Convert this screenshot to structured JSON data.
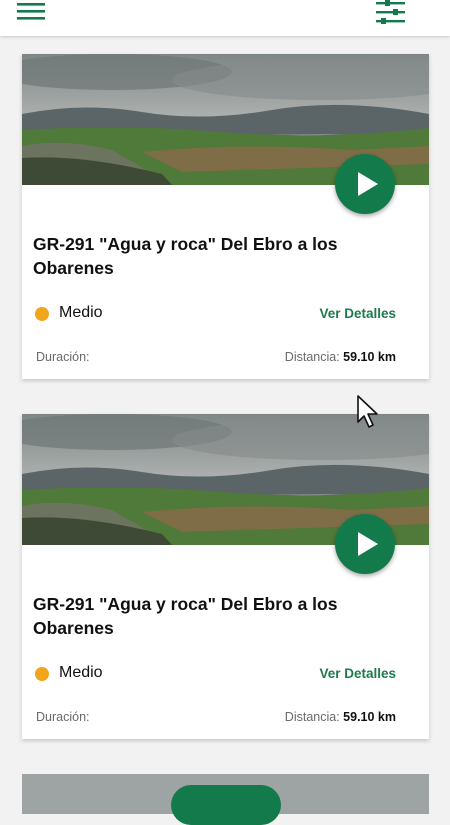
{
  "appbar": {
    "menu_icon": "menu-icon",
    "filter_icon": "filter-sliders-icon"
  },
  "routes": [
    {
      "title": "GR-291 \"Agua y roca\" Del Ebro a los Obarenes",
      "difficulty": "Medio",
      "details_label": "Ver Detalles",
      "duration_label": "Duración:",
      "distance_label": "Distancia:",
      "distance_value": "59.10 km"
    },
    {
      "title": "GR-291 \"Agua y roca\" Del Ebro a los Obarenes",
      "difficulty": "Medio",
      "details_label": "Ver Detalles",
      "duration_label": "Duración:",
      "distance_label": "Distancia:",
      "distance_value": "59.10 km"
    }
  ],
  "colors": {
    "brand_green": "#137a4c",
    "difficulty_medium": "#f2a51a",
    "link_green": "#1e7a4a"
  }
}
